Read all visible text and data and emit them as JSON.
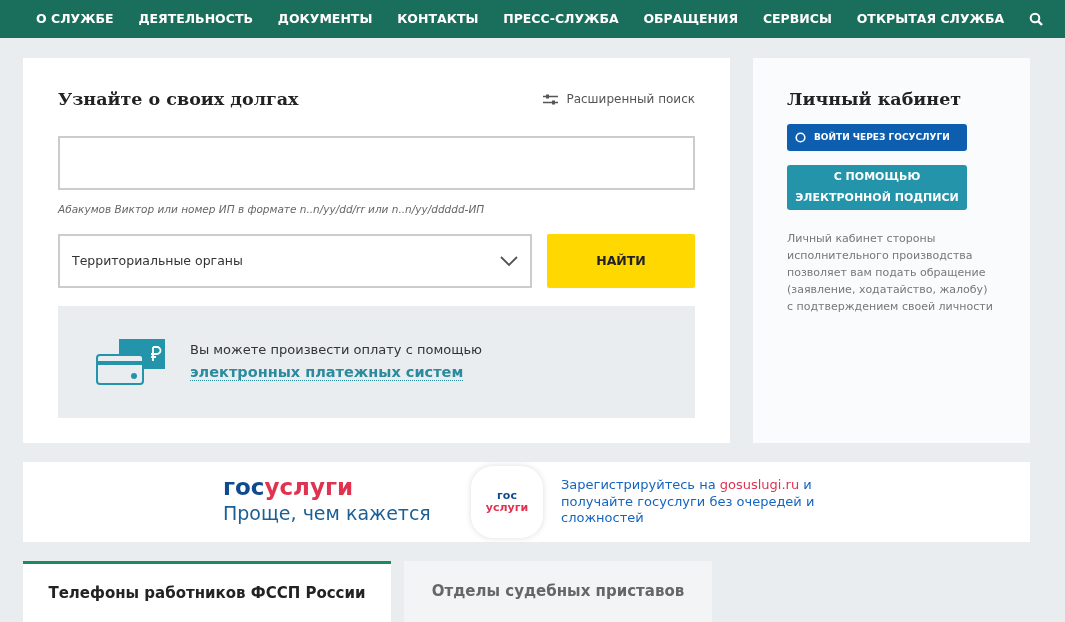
{
  "nav": {
    "items": [
      "О СЛУЖБЕ",
      "ДЕЯТЕЛЬНОСТЬ",
      "ДОКУМЕНТЫ",
      "КОНТАКТЫ",
      "ПРЕСС-СЛУЖБА",
      "ОБРАЩЕНИЯ",
      "СЕРВИСЫ",
      "ОТКРЫТАЯ СЛУЖБА"
    ]
  },
  "debt_search": {
    "title": "Узнайте о своих долгах",
    "advanced_link": "Расширенный поиск",
    "hint": "Абакумов Виктор или номер ИП в формате n..n/yy/dd/rr или n..n/yy/ddddd-ИП",
    "region_select": "Территориальные органы",
    "find_button": "НАЙТИ",
    "payment": {
      "text": "Вы можете произвести оплату с помощью",
      "link": "электронных платежных систем"
    }
  },
  "cabinet": {
    "title": "Личный кабинет",
    "gosuslugi_button": "ВОЙТИ ЧЕРЕЗ ГОСУСЛУГИ",
    "signature_button": "С ПОМОЩЬЮ ЭЛЕКТРОННОЙ ПОДПИСИ",
    "description": "Личный кабинет стороны исполнительного производства позволяет вам подать обращение (заявление, ходатайство, жалобу) с подтверждением своей личности"
  },
  "banner": {
    "logo": [
      {
        "text": "гос",
        "color": "#0d4a8f"
      },
      {
        "text": "услуги",
        "color": "#e0334f"
      }
    ],
    "slogan": "Проще, чем кажется",
    "badge": [
      {
        "text": "гос",
        "color": "#0d4a8f"
      },
      {
        "text": "услуги",
        "color": "#e0334f"
      }
    ],
    "message": [
      {
        "text": "Зарегистрируйтесь на ",
        "color": "#1565c0"
      },
      {
        "text": "gosuslugi.ru",
        "color": "#e0334f"
      }
    ],
    "message_rest": "и получайте госуслуги без очередей и сложностей"
  },
  "tabs": [
    {
      "label": "Телефоны работников ФССП России",
      "selected": true
    },
    {
      "label": "Отделы судебных приставов",
      "selected": false
    }
  ]
}
